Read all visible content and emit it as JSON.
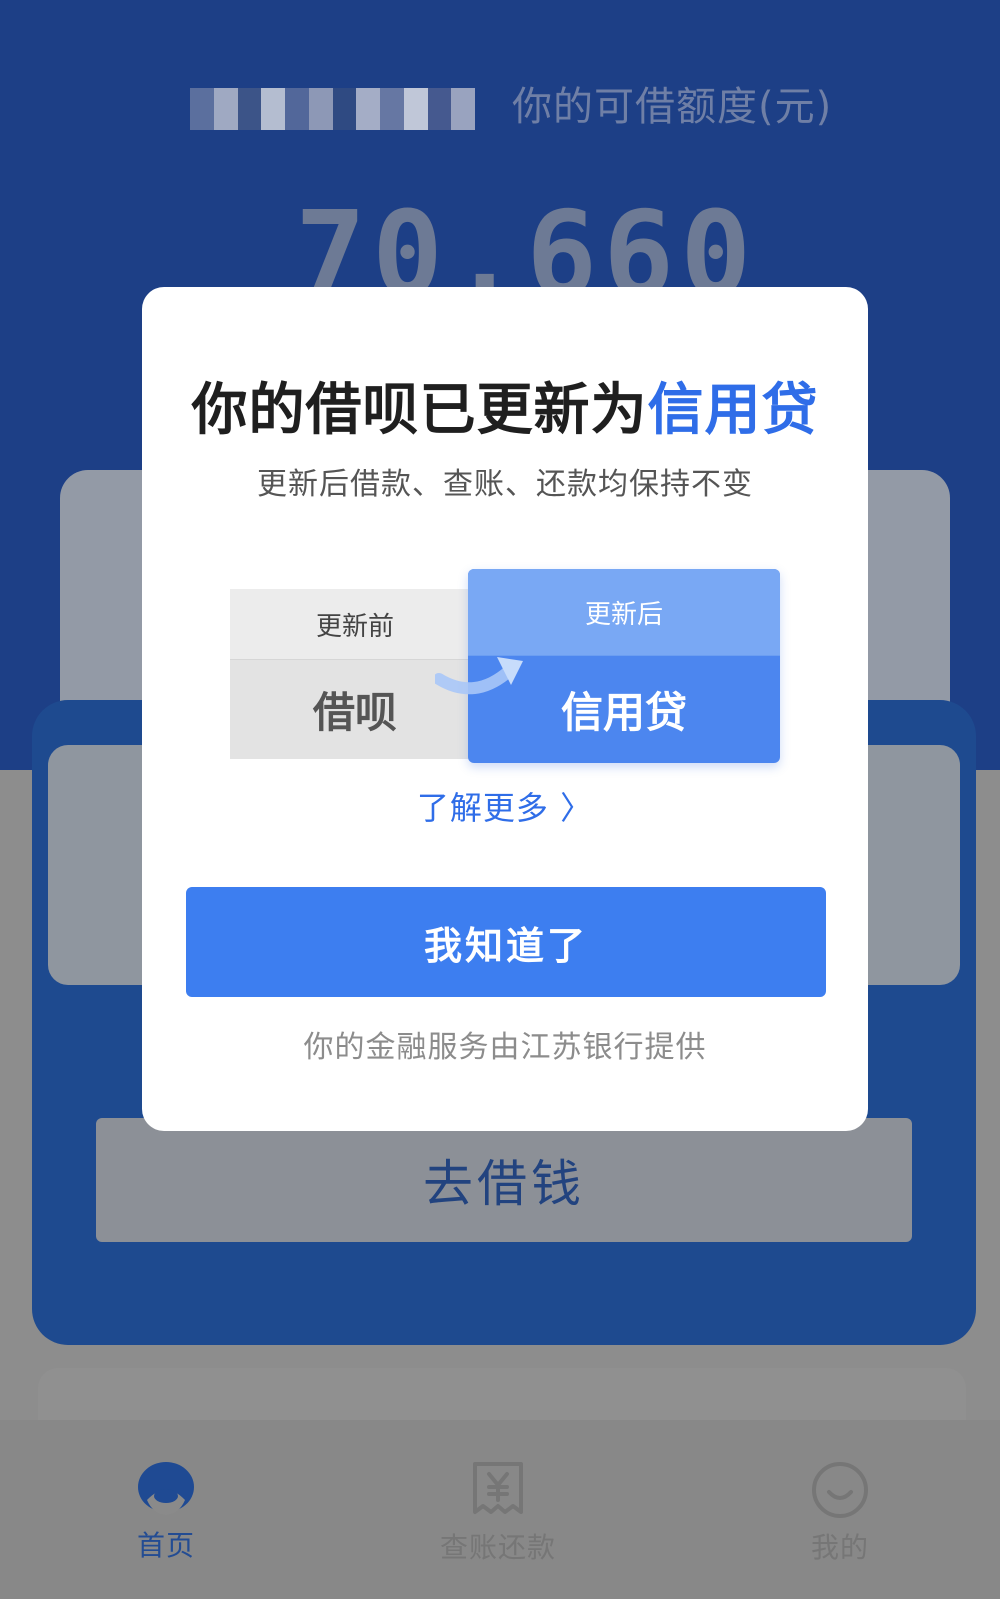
{
  "header": {
    "quota_label": "你的可借额度(元)",
    "amount": "70,660"
  },
  "main": {
    "borrow_button": "去借钱"
  },
  "tabbar": {
    "items": [
      {
        "label": "首页",
        "icon": "home-icon",
        "active": true
      },
      {
        "label": "查账还款",
        "icon": "yuan-bill-icon",
        "active": false
      },
      {
        "label": "我的",
        "icon": "smile-face-icon",
        "active": false
      }
    ]
  },
  "modal": {
    "title_prefix": "你的借呗已更新为",
    "title_highlight": "信用贷",
    "subtitle": "更新后借款、查账、还款均保持不变",
    "before_label": "更新前",
    "before_name": "借呗",
    "after_label": "更新后",
    "after_name": "信用贷",
    "learn_more": "了解更多 〉",
    "confirm_button": "我知道了",
    "footer_note": "你的金融服务由江苏银行提供"
  },
  "colors": {
    "brand_blue": "#2f6de8",
    "button_blue": "#3d7ef0",
    "header_bg": "#1d3f86"
  }
}
